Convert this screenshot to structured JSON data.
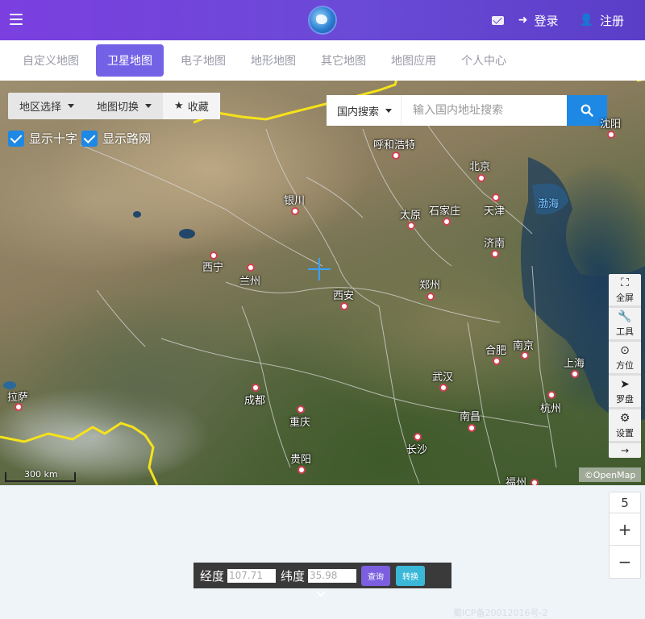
{
  "header": {
    "menu_icon": "hamburger-icon",
    "logo": "globe-logo",
    "login_label": "登录",
    "register_label": "注册",
    "accent": "#6a4ad6"
  },
  "tabs": [
    {
      "label": "自定义地图",
      "active": false
    },
    {
      "label": "卫星地图",
      "active": true
    },
    {
      "label": "电子地图",
      "active": false
    },
    {
      "label": "地形地图",
      "active": false
    },
    {
      "label": "其它地图",
      "active": false
    },
    {
      "label": "地图应用",
      "active": false
    },
    {
      "label": "个人中心",
      "active": false
    }
  ],
  "map_toolbar": {
    "region_select": "地区选择",
    "map_switch": "地图切换",
    "favorite": "收藏",
    "show_cross": "显示十字",
    "show_roads": "显示路网"
  },
  "search": {
    "scope": "国内搜索",
    "placeholder": "输入国内地址搜索"
  },
  "cities": [
    "呼和浩特",
    "北京",
    "银川",
    "太原",
    "石家庄",
    "天津",
    "济南",
    "西宁",
    "兰州",
    "西安",
    "郑州",
    "合肥",
    "南京",
    "上海",
    "武汉",
    "杭州",
    "拉萨",
    "成都",
    "重庆",
    "南昌",
    "长沙",
    "贵阳",
    "福州",
    "沈阳"
  ],
  "seas": [
    "渤海"
  ],
  "right_tools": [
    {
      "icon": "fullscreen-icon",
      "label": "全屏"
    },
    {
      "icon": "wrench-icon",
      "label": "工具"
    },
    {
      "icon": "direction-icon",
      "label": "方位"
    },
    {
      "icon": "compass-icon",
      "label": "罗盘"
    },
    {
      "icon": "gear-icon",
      "label": "设置"
    }
  ],
  "scale_label": "300 km",
  "copyright_text": "©OpenMap",
  "zoom": {
    "level": "5",
    "plus": "+",
    "minus": "−"
  },
  "coords": {
    "lng_label": "经度",
    "lat_label": "纬度",
    "lng_value": "107.71",
    "lat_value": "35.98",
    "query_label": "查询",
    "convert_label": "转换"
  },
  "icp": "蜀ICP备20012016号-2"
}
